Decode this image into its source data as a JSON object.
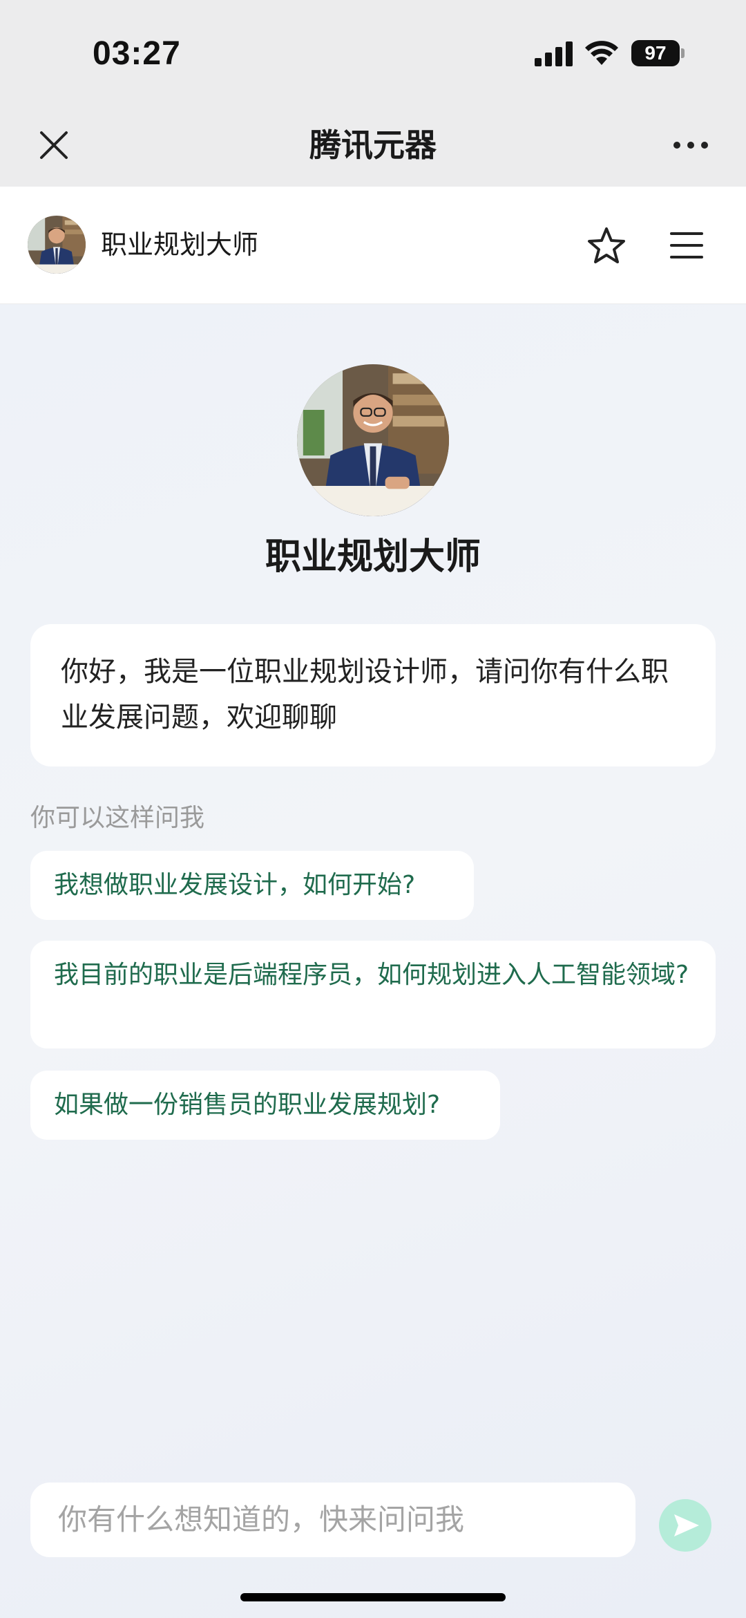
{
  "status_bar": {
    "time": "03:27",
    "battery": "97"
  },
  "nav": {
    "title": "腾讯元器",
    "close_icon": "close-icon",
    "more_icon": "more-icon"
  },
  "header": {
    "name": "职业规划大师",
    "star_icon": "star-icon",
    "menu_icon": "menu-icon"
  },
  "agent": {
    "name": "职业规划大师"
  },
  "greeting": "你好，我是一位职业规划设计师，请问你有什么职业发展问题，欢迎聊聊",
  "suggestions": {
    "title": "你可以这样问我",
    "items": [
      {
        "text": "我想做职业发展设计，如何开始?"
      },
      {
        "text": "我目前的职业是后端程序员，如何规划进入人工智能领域?"
      },
      {
        "text": "如果做一份销售员的职业发展规划?"
      }
    ]
  },
  "input": {
    "placeholder": "你有什么想知道的，快来问问我"
  },
  "colors": {
    "accent": "#1f6b4d",
    "send_button": "#b5ecd9",
    "background": "#eef1f7"
  }
}
